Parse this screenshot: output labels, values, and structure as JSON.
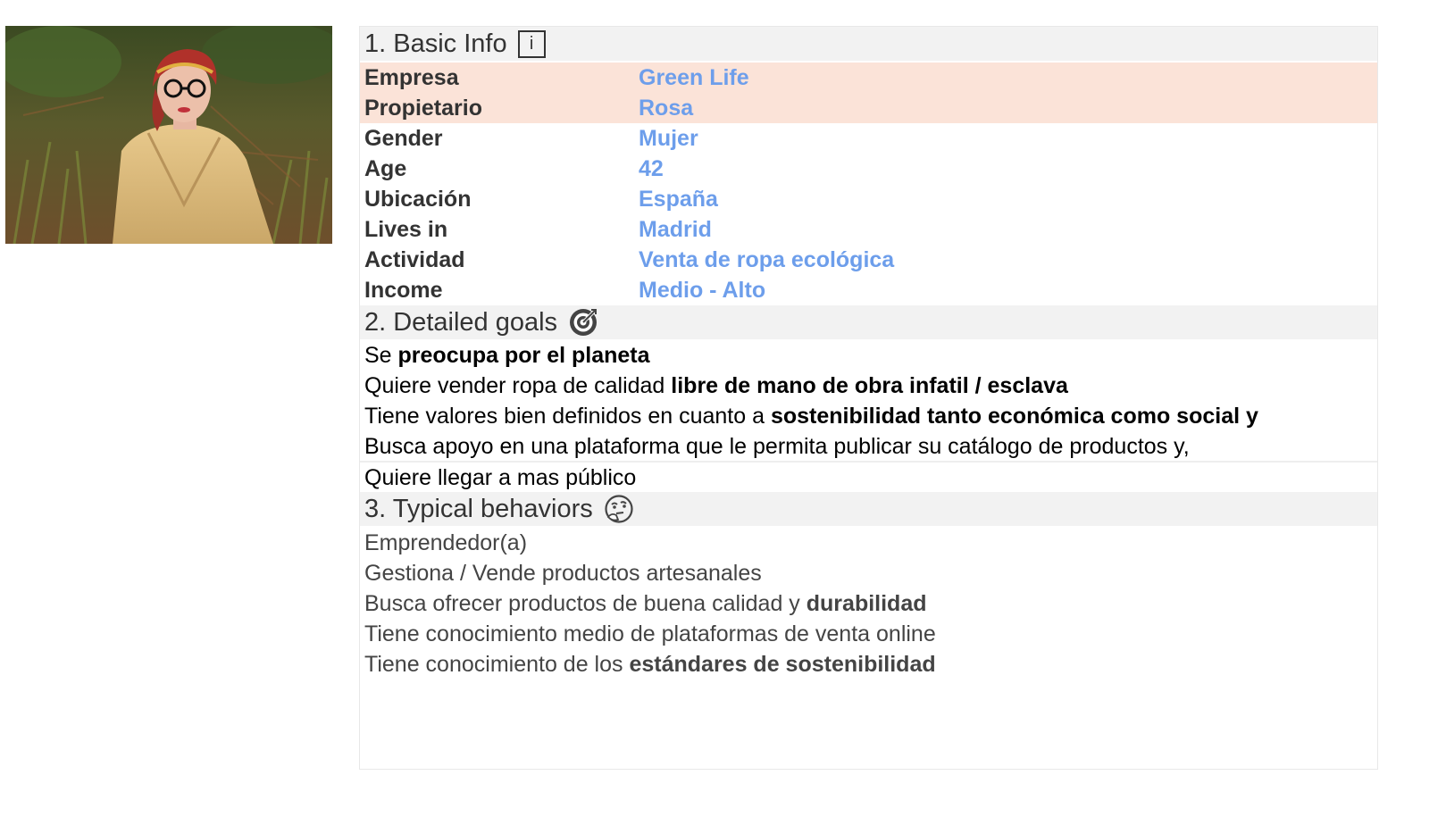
{
  "section1": {
    "title": "1. Basic Info",
    "info_icon_text": "i",
    "rows": [
      {
        "key": "Empresa",
        "value": "Green Life"
      },
      {
        "key": "Propietario",
        "value": "Rosa"
      },
      {
        "key": "Gender",
        "value": "Mujer"
      },
      {
        "key": "Age",
        "value": "42"
      },
      {
        "key": "Ubicación",
        "value": "España"
      },
      {
        "key": "Lives in",
        "value": "Madrid"
      },
      {
        "key": "Actividad",
        "value": "Venta de ropa ecológica"
      },
      {
        "key": "Income",
        "value": "Medio - Alto"
      }
    ]
  },
  "section2": {
    "title": "2. Detailed goals",
    "icon": "target-icon",
    "lines": [
      {
        "plain": "Se ",
        "bold": "preocupa por el planeta"
      },
      {
        "plain": "Quiere vender ropa de calidad ",
        "bold": "libre de mano de obra infatil / esclava"
      },
      {
        "plain": "Tiene valores bien definidos en cuanto a ",
        "bold": "sostenibilidad tanto económica como social y"
      },
      {
        "plain": "Busca apoyo en una plataforma que le permita publicar su catálogo de productos y,",
        "bold": ""
      },
      {
        "plain": "Quiere llegar a mas público",
        "bold": ""
      }
    ]
  },
  "section3": {
    "title": "3. Typical behaviors",
    "icon": "thinking-face-icon",
    "lines": [
      {
        "plain": "Emprendedor(a)",
        "bold": ""
      },
      {
        "plain": "Gestiona / Vende productos artesanales",
        "bold": ""
      },
      {
        "plain": "Busca ofrecer productos de buena calidad y ",
        "bold": "durabilidad"
      },
      {
        "plain": "Tiene conocimiento medio de plataformas de venta online",
        "bold": ""
      },
      {
        "plain": "Tiene conocimiento de los ",
        "bold": "estándares de sostenibilidad"
      }
    ]
  },
  "colors": {
    "value_blue": "#6d9eeb",
    "highlight_peach": "#fbe3d8",
    "header_gray": "#f2f2f2"
  }
}
